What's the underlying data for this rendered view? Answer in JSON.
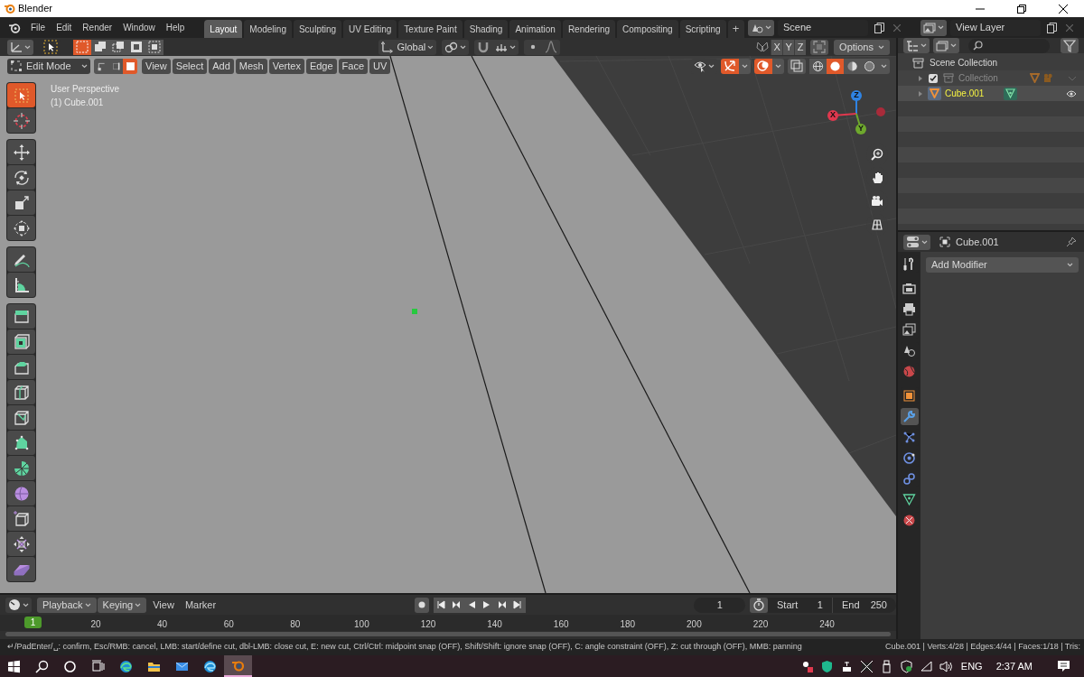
{
  "window": {
    "title": "Blender"
  },
  "menu": [
    "File",
    "Edit",
    "Render",
    "Window",
    "Help"
  ],
  "workspaces": [
    {
      "label": "Layout",
      "selected": true
    },
    {
      "label": "Modeling",
      "selected": false
    },
    {
      "label": "Sculpting",
      "selected": false
    },
    {
      "label": "UV Editing",
      "selected": false
    },
    {
      "label": "Texture Paint",
      "selected": false
    },
    {
      "label": "Shading",
      "selected": false
    },
    {
      "label": "Animation",
      "selected": false
    },
    {
      "label": "Rendering",
      "selected": false
    },
    {
      "label": "Compositing",
      "selected": false
    },
    {
      "label": "Scripting",
      "selected": false
    }
  ],
  "add_workspace": "+",
  "scene": "Scene",
  "view_layer": "View Layer",
  "tool_settings": {
    "orientation": "Global",
    "mirror_axes": [
      "X",
      "Y",
      "Z"
    ],
    "options": "Options"
  },
  "mode_header": {
    "mode": "Edit Mode",
    "select_modes": [
      {
        "kind": "vertex",
        "selected": false
      },
      {
        "kind": "edge",
        "selected": false
      },
      {
        "kind": "face",
        "selected": true
      }
    ],
    "menus": [
      "View",
      "Select",
      "Add",
      "Mesh",
      "Vertex",
      "Edge",
      "Face",
      "UV"
    ]
  },
  "viewport": {
    "view_name": "User Perspective",
    "object_info": "(1) Cube.001",
    "gizmo_axes": [
      "Z",
      "X",
      "Y"
    ]
  },
  "toolbar": [
    [
      {
        "kind": "select_box",
        "selected": true
      },
      {
        "kind": "cursor",
        "selected": false
      }
    ],
    [
      {
        "kind": "move",
        "selected": false
      },
      {
        "kind": "rotate",
        "selected": false
      },
      {
        "kind": "scale",
        "selected": false
      },
      {
        "kind": "transform",
        "selected": false
      }
    ],
    [
      {
        "kind": "annotate",
        "selected": false
      },
      {
        "kind": "measure",
        "selected": false
      }
    ],
    [
      {
        "kind": "extrude",
        "selected": false
      },
      {
        "kind": "inset",
        "selected": false
      },
      {
        "kind": "bevel",
        "selected": false
      },
      {
        "kind": "loop_cut",
        "selected": false
      },
      {
        "kind": "knife",
        "selected": false
      },
      {
        "kind": "poly_build",
        "selected": false
      },
      {
        "kind": "spin",
        "selected": false
      },
      {
        "kind": "smooth",
        "selected": false
      },
      {
        "kind": "shrink",
        "selected": false
      },
      {
        "kind": "push",
        "selected": false
      },
      {
        "kind": "shear",
        "selected": false
      }
    ]
  ],
  "outliner": {
    "root": "Scene Collection",
    "children": [
      {
        "kind": "collection",
        "label": "Collection",
        "checked": true,
        "selected": false
      },
      {
        "kind": "object",
        "label": "Cube.001",
        "selected": true
      }
    ]
  },
  "properties": {
    "object": "Cube.001",
    "add_modifier": "Add Modifier",
    "tab_groups": [
      [
        {
          "kind": "tool",
          "selected": false
        }
      ],
      [
        {
          "kind": "render",
          "selected": false
        },
        {
          "kind": "output",
          "selected": false
        },
        {
          "kind": "view_layer",
          "selected": false
        },
        {
          "kind": "scene",
          "selected": false
        },
        {
          "kind": "world",
          "selected": false
        }
      ],
      [
        {
          "kind": "object",
          "selected": false
        },
        {
          "kind": "modifier",
          "selected": true
        },
        {
          "kind": "particles",
          "selected": false
        },
        {
          "kind": "physics",
          "selected": false
        },
        {
          "kind": "constraints",
          "selected": false
        },
        {
          "kind": "data",
          "selected": false
        },
        {
          "kind": "material",
          "selected": false
        }
      ]
    ]
  },
  "timeline": {
    "menus": [
      {
        "label": "Playback",
        "dropdown": true
      },
      {
        "label": "Keying",
        "dropdown": true
      },
      {
        "label": "View",
        "dropdown": false
      },
      {
        "label": "Marker",
        "dropdown": false
      }
    ],
    "current_frame": "1",
    "start_label": "Start",
    "start": "1",
    "end_label": "End",
    "end": "250",
    "playhead": "1",
    "ruler": [
      "20",
      "40",
      "60",
      "80",
      "100",
      "120",
      "140",
      "160",
      "180",
      "200",
      "220",
      "240"
    ]
  },
  "status_bar": {
    "hint": "↵/PadEnter/␣: confirm, Esc/RMB: cancel, LMB: start/define cut, dbl-LMB: close cut, E: new cut, Ctrl/Ctrl: midpoint snap (OFF), Shift/Shift: ignore snap (OFF), C: angle constraint (OFF), Z: cut through (OFF), MMB: panning",
    "stats": "Cube.001 | Verts:4/28 | Edges:4/44 | Faces:1/18 | Tris:"
  },
  "taskbar": {
    "language": "ENG",
    "time": "2:37 AM"
  }
}
